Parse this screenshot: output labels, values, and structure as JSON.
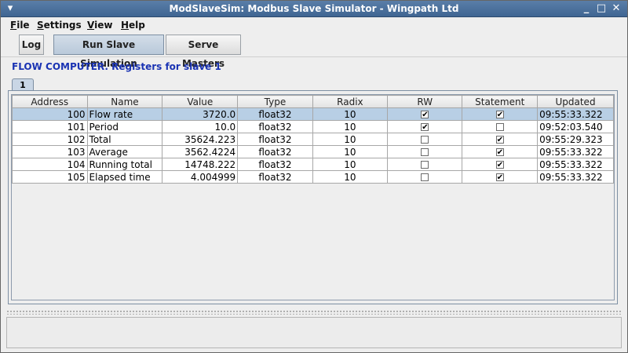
{
  "window": {
    "title": "ModSlaveSim:  Modbus Slave Simulator - Wingpath Ltd"
  },
  "menu": [
    {
      "label": "File"
    },
    {
      "label": "Settings"
    },
    {
      "label": "View"
    },
    {
      "label": "Help"
    }
  ],
  "toolbar": {
    "log_label": "Log",
    "run_label": "Run Slave Simulation",
    "serve_label": "Serve Masters"
  },
  "heading": "FLOW COMPUTER.  Registers for slave 1",
  "tab_label": "1",
  "table": {
    "columns": [
      "Address",
      "Name",
      "Value",
      "Type",
      "Radix",
      "RW",
      "Statement",
      "Updated"
    ],
    "rows": [
      {
        "address": "100",
        "name": "Flow rate",
        "value": "3720.0",
        "type": "float32",
        "radix": "10",
        "rw": true,
        "statement": true,
        "updated": "09:55:33.322",
        "selected": true
      },
      {
        "address": "101",
        "name": "Period",
        "value": "10.0",
        "type": "float32",
        "radix": "10",
        "rw": true,
        "statement": false,
        "updated": "09:52:03.540",
        "selected": false
      },
      {
        "address": "102",
        "name": "Total",
        "value": "35624.223",
        "type": "float32",
        "radix": "10",
        "rw": false,
        "statement": true,
        "updated": "09:55:29.323",
        "selected": false
      },
      {
        "address": "103",
        "name": "Average",
        "value": "3562.4224",
        "type": "float32",
        "radix": "10",
        "rw": false,
        "statement": true,
        "updated": "09:55:33.322",
        "selected": false
      },
      {
        "address": "104",
        "name": "Running total",
        "value": "14748.222",
        "type": "float32",
        "radix": "10",
        "rw": false,
        "statement": true,
        "updated": "09:55:33.322",
        "selected": false
      },
      {
        "address": "105",
        "name": "Elapsed time",
        "value": "4.004999",
        "type": "float32",
        "radix": "10",
        "rw": false,
        "statement": true,
        "updated": "09:55:33.322",
        "selected": false
      }
    ]
  },
  "colors": {
    "title_bar": "#4a6f9b",
    "heading_text": "#1a33b3",
    "selected_row": "#b8cfe5"
  },
  "icons": {
    "window_menu": "chevron-down-icon",
    "minimize": "minimize-icon",
    "maximize": "maximize-icon",
    "close": "close-icon"
  }
}
